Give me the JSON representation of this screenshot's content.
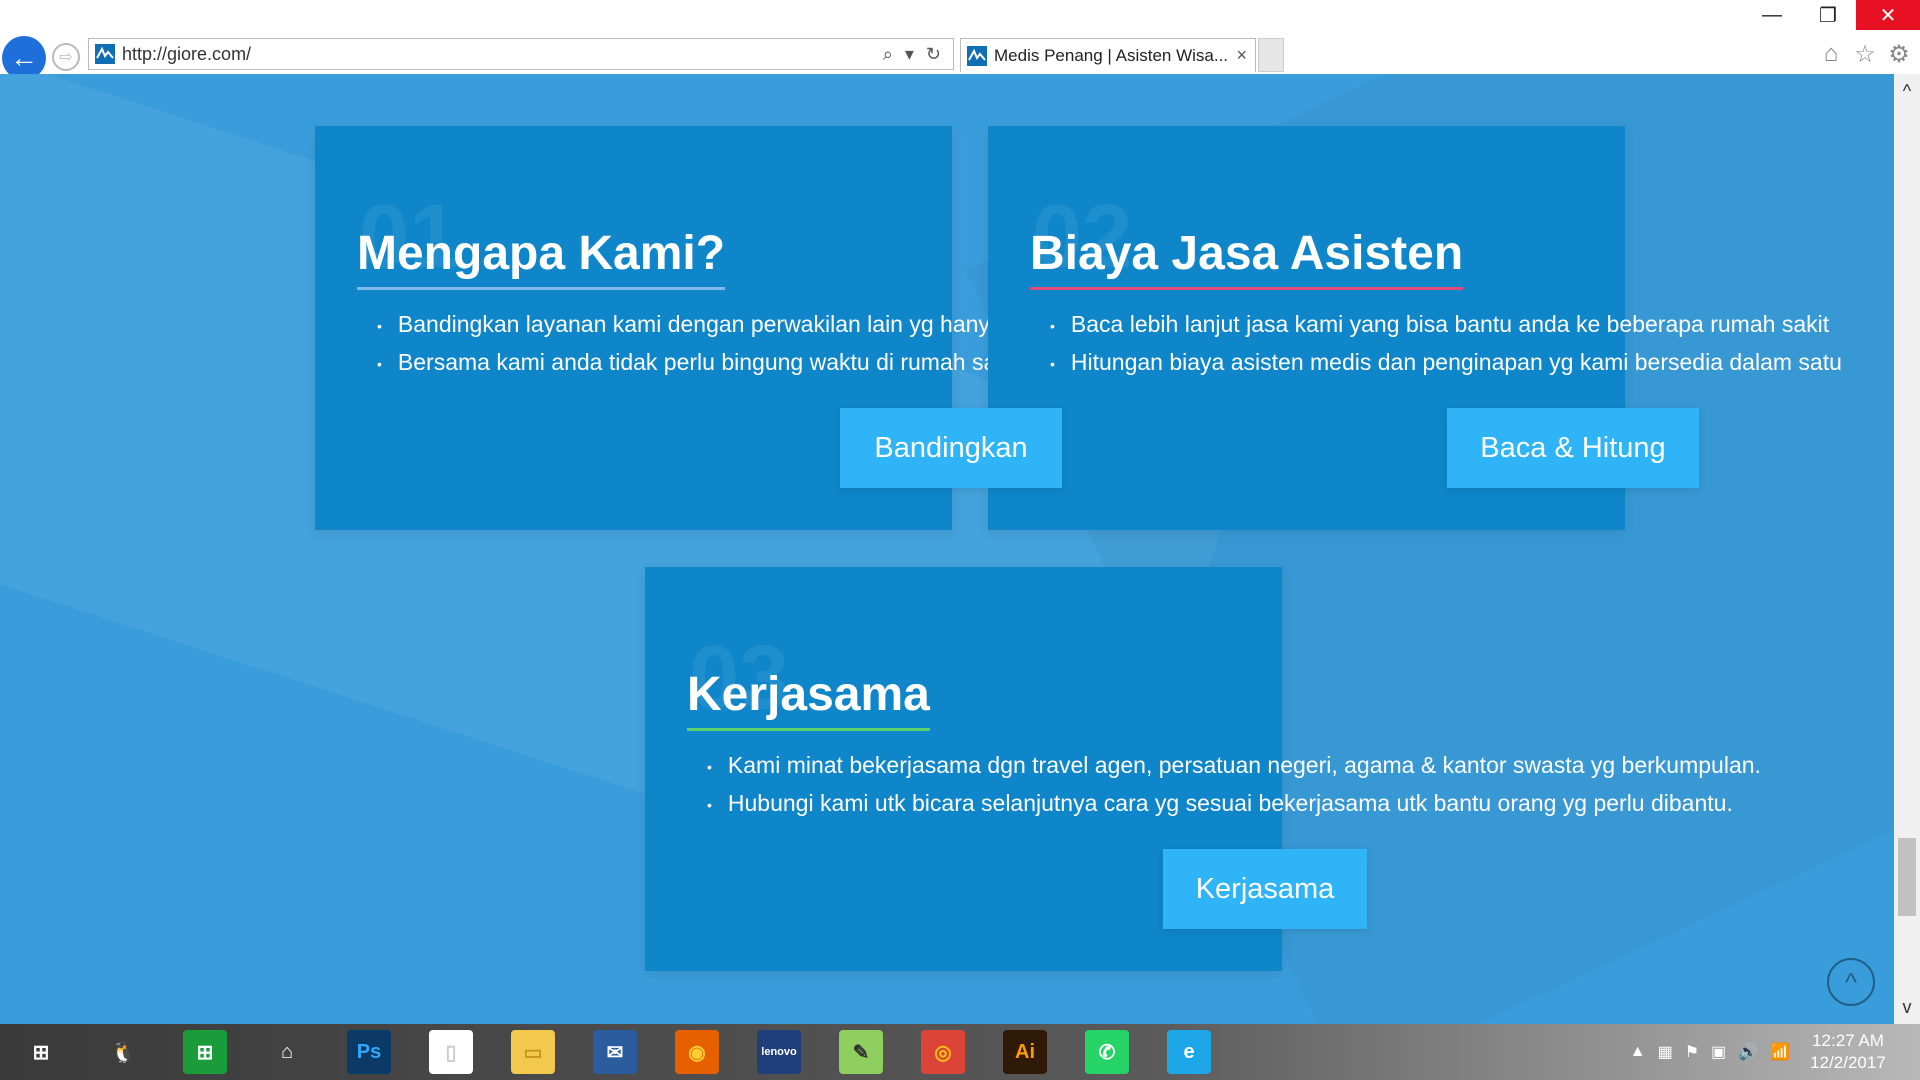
{
  "window": {
    "minimize": "—",
    "restore": "❐",
    "close": "✕"
  },
  "nav": {
    "back": "←",
    "forward": "⇨"
  },
  "address": {
    "url": "http://giore.com/",
    "search_icon": "⌕",
    "dropdown_icon": "▾",
    "refresh_icon": "↻"
  },
  "tab": {
    "title": "Medis Penang | Asisten Wisa...",
    "close": "×"
  },
  "ie_tools": {
    "home": "⌂",
    "favorites": "☆",
    "settings": "⚙"
  },
  "cards": [
    {
      "num": "01",
      "title": "Mengapa Kami?",
      "underline": "#7fb8ec",
      "items": [
        "Bandingkan layanan kami dengan perwakilan lain yg hanya",
        "Bersama kami anda tidak perlu bingung waktu di rumah sakit"
      ],
      "button": "Bandingkan"
    },
    {
      "num": "02",
      "title": "Biaya Jasa Asisten",
      "underline": "#e64a7b",
      "items": [
        "Baca lebih lanjut jasa kami yang bisa bantu anda ke beberapa rumah sakit",
        "Hitungan biaya asisten medis dan penginapan yg kami bersedia dalam satu"
      ],
      "button": "Baca & Hitung"
    },
    {
      "num": "03",
      "title": "Kerjasama",
      "underline": "#5cd16a",
      "items": [
        "Kami minat bekerjasama dgn travel agen, persatuan negeri, agama & kantor swasta yg berkumpulan.",
        "Hubungi kami utk bicara selanjutnya cara yg sesuai bekerjasama utk bantu orang yg perlu dibantu."
      ],
      "button": "Kerjasama"
    }
  ],
  "scroll": {
    "up": "^",
    "down": "v",
    "to_top": "^"
  },
  "taskbar": {
    "apps": [
      {
        "name": "windows-start-icon",
        "glyph": "⊞",
        "bg": "transparent",
        "color": "#ffffff"
      },
      {
        "name": "qq-icon",
        "glyph": "🐧",
        "bg": "transparent",
        "color": "#ffffff"
      },
      {
        "name": "store-icon",
        "glyph": "⊞",
        "bg": "#1a9c3a",
        "color": "#ffffff"
      },
      {
        "name": "home-icon",
        "glyph": "⌂",
        "bg": "transparent",
        "color": "#ffffff"
      },
      {
        "name": "photoshop-icon",
        "glyph": "Ps",
        "bg": "#0b3a66",
        "color": "#31a8ff"
      },
      {
        "name": "file-icon",
        "glyph": "▯",
        "bg": "#ffffff",
        "color": "#cccccc"
      },
      {
        "name": "folder-icon",
        "glyph": "▭",
        "bg": "#f2c94c",
        "color": "#c9961a"
      },
      {
        "name": "thunderbird-icon",
        "glyph": "✉",
        "bg": "#2b5c9e",
        "color": "#ffffff"
      },
      {
        "name": "firefox-icon",
        "glyph": "◉",
        "bg": "#e66000",
        "color": "#ffcc33"
      },
      {
        "name": "lenovo-icon",
        "glyph": "lenovo",
        "bg": "#1f3f7a",
        "color": "#ffffff"
      },
      {
        "name": "notepad-icon",
        "glyph": "✎",
        "bg": "#8fcf5f",
        "color": "#333333"
      },
      {
        "name": "chrome-icon",
        "glyph": "◎",
        "bg": "#db4437",
        "color": "#f4c20d"
      },
      {
        "name": "illustrator-icon",
        "glyph": "Ai",
        "bg": "#2e1a06",
        "color": "#ff9a00"
      },
      {
        "name": "whatsapp-icon",
        "glyph": "✆",
        "bg": "#25d366",
        "color": "#ffffff"
      },
      {
        "name": "internet-explorer-icon",
        "glyph": "e",
        "bg": "#1ea7e8",
        "color": "#ffffff"
      }
    ],
    "tray": [
      "▲",
      "▦",
      "⚑",
      "▣",
      "🔊",
      "📶"
    ],
    "time": "12:27 AM",
    "date": "12/2/2017"
  }
}
